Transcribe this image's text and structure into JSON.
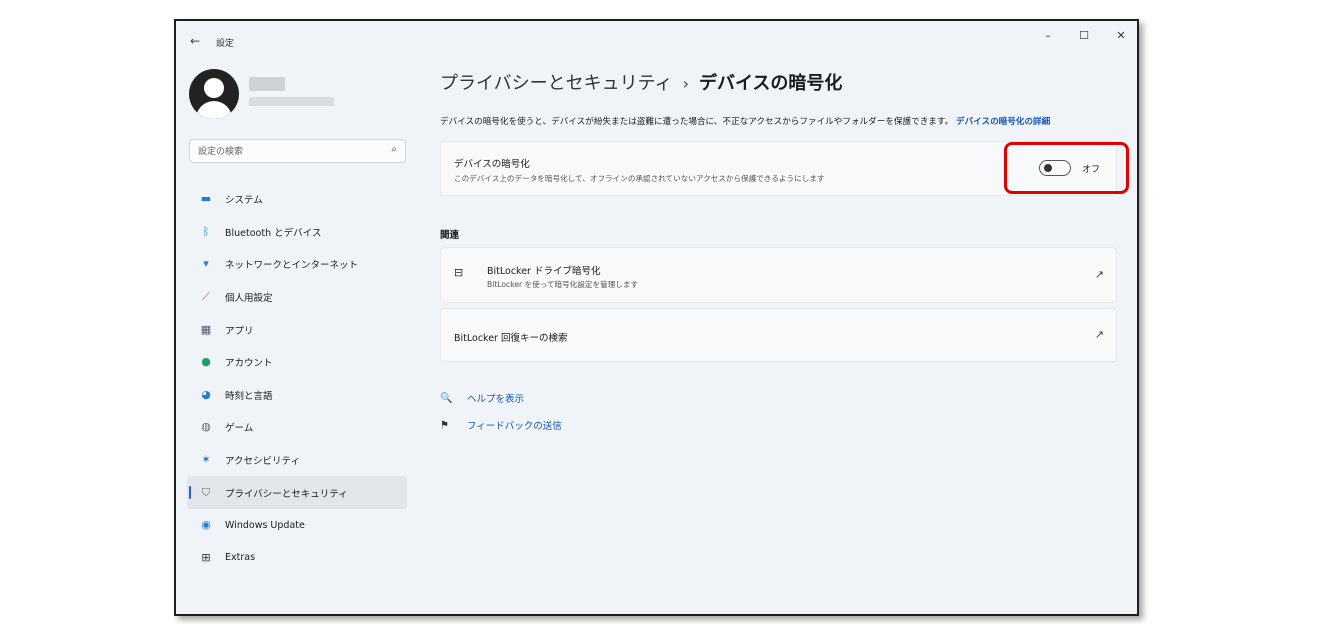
{
  "window": {
    "app_title": "設定",
    "back_glyph": "←",
    "minimize_glyph": "–",
    "maximize_glyph": "☐",
    "close_glyph": "✕"
  },
  "search": {
    "placeholder": "設定の検索",
    "icon_glyph": "⌕"
  },
  "sidebar": {
    "items": [
      {
        "label": "システム",
        "icon": "display-icon",
        "glyph": "▬",
        "color": "#1f7fd6"
      },
      {
        "label": "Bluetooth とデバイス",
        "icon": "bluetooth-icon",
        "glyph": "ᛒ",
        "color": "#1f7fd6"
      },
      {
        "label": "ネットワークとインターネット",
        "icon": "wifi-icon",
        "glyph": "▾",
        "color": "#1f7fd6"
      },
      {
        "label": "個人用設定",
        "icon": "brush-icon",
        "glyph": "⟋",
        "color": "#c56a1e"
      },
      {
        "label": "アプリ",
        "icon": "apps-icon",
        "glyph": "▦",
        "color": "#4a5a70"
      },
      {
        "label": "アカウント",
        "icon": "account-icon",
        "glyph": "●",
        "color": "#1f9d62"
      },
      {
        "label": "時刻と言語",
        "icon": "globe-clock-icon",
        "glyph": "◕",
        "color": "#1f7fd6"
      },
      {
        "label": "ゲーム",
        "icon": "gamepad-icon",
        "glyph": "◍",
        "color": "#666666"
      },
      {
        "label": "アクセシビリティ",
        "icon": "accessibility-icon",
        "glyph": "✶",
        "color": "#1f6fc6"
      },
      {
        "label": "プライバシーとセキュリティ",
        "icon": "shield-icon",
        "glyph": "⛉",
        "color": "#6a6a6a",
        "active": true
      },
      {
        "label": "Windows Update",
        "icon": "windows-update-icon",
        "glyph": "◉",
        "color": "#1f7fd6"
      },
      {
        "label": "Extras",
        "icon": "extras-grid-icon",
        "glyph": "⊞",
        "color": "#333333"
      }
    ]
  },
  "main": {
    "breadcrumb_parent": "プライバシーとセキュリティ",
    "breadcrumb_sep": "›",
    "breadcrumb_current": "デバイスの暗号化",
    "description": "デバイスの暗号化を使うと、デバイスが紛失または盗難に遭った場合に、不正なアクセスからファイルやフォルダーを保護できます。",
    "description_link": "デバイスの暗号化の詳細",
    "encryption_card": {
      "title": "デバイスの暗号化",
      "subtitle": "このデバイス上のデータを暗号化して、オフラインの承認されていないアクセスから保護できるようにします",
      "toggle_state": "オフ",
      "toggle_on": false
    },
    "related_label": "関連",
    "bitlocker_drive": {
      "title": "BitLocker ドライブ暗号化",
      "subtitle": "BitLocker を使って暗号化設定を管理します",
      "icon_glyph": "⊟",
      "ext_glyph": "↗"
    },
    "bitlocker_recovery": {
      "title": "BitLocker 回復キーの検索",
      "ext_glyph": "↗"
    },
    "help_link": {
      "label": "ヘルプを表示",
      "glyph": "🔍"
    },
    "feedback_link": {
      "label": "フィードバックの送信",
      "glyph": "⚑"
    }
  },
  "colors": {
    "accent": "#1256b5",
    "highlight_box": "#e00000",
    "window_bg": "#f0f4f9"
  }
}
